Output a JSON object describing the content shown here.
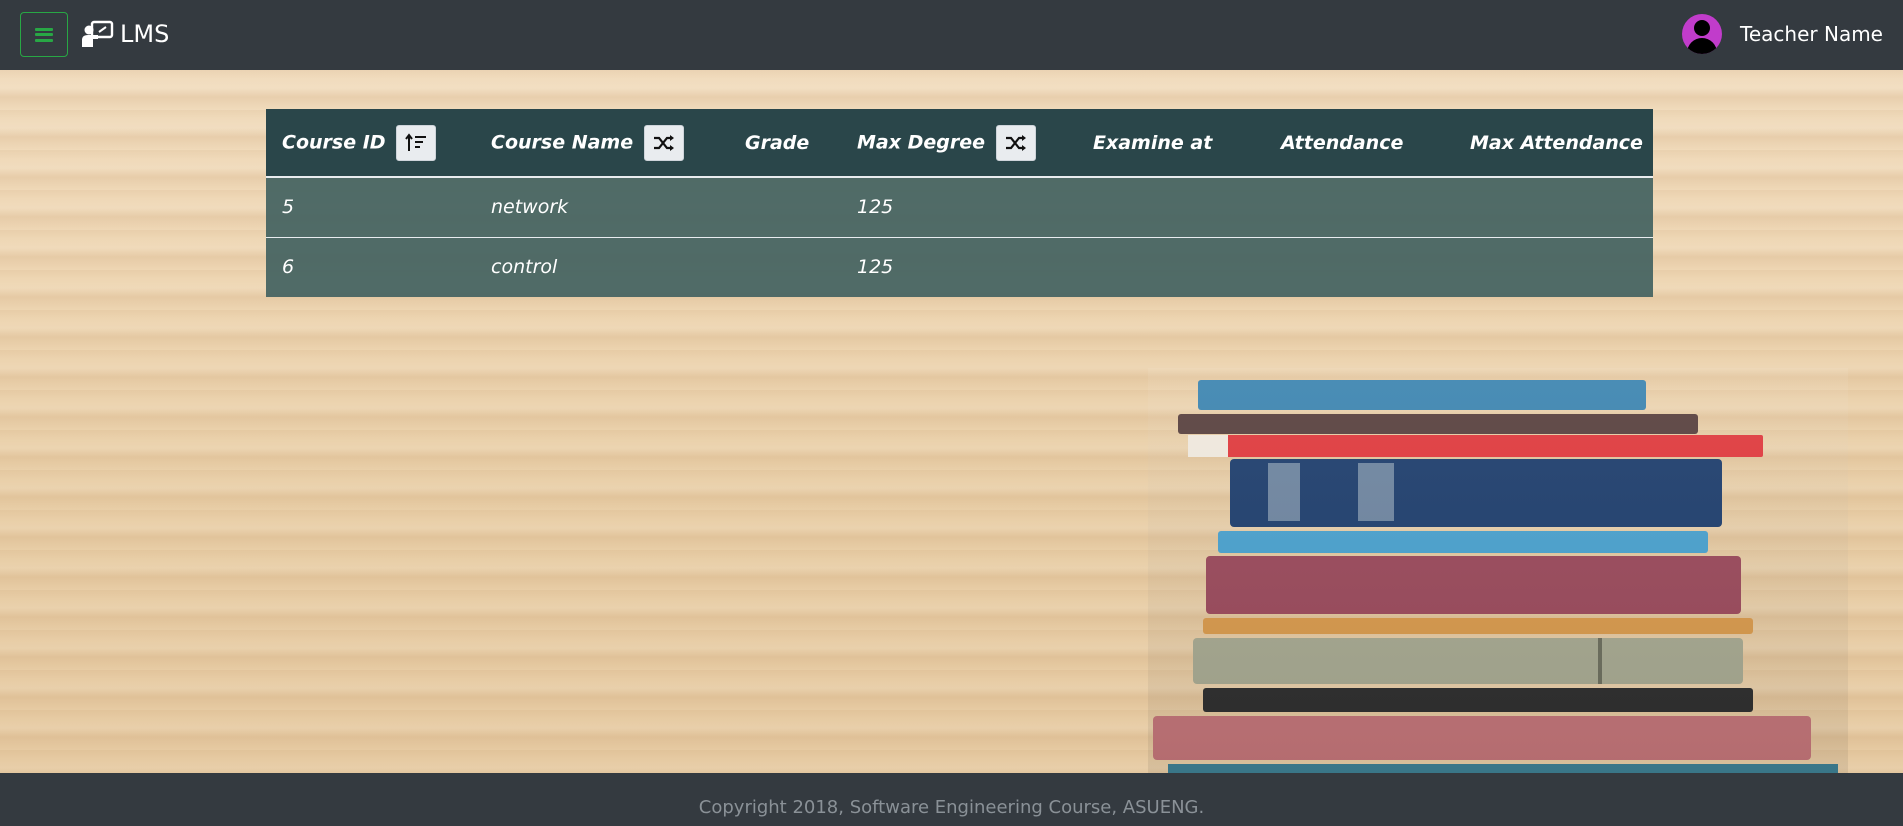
{
  "navbar": {
    "brand": "LMS",
    "user_name": "Teacher Name"
  },
  "table": {
    "headers": {
      "course_id": "Course ID",
      "course_name": "Course Name",
      "grade": "Grade",
      "max_degree": "Max Degree",
      "examine_at": "Examine at",
      "attendance": "Attendance",
      "max_attendance": "Max Attendance"
    },
    "rows": [
      {
        "course_id": "5",
        "course_name": "network",
        "grade": "",
        "max_degree": "125",
        "examine_at": "",
        "attendance": "",
        "max_attendance": ""
      },
      {
        "course_id": "6",
        "course_name": "control",
        "grade": "",
        "max_degree": "125",
        "examine_at": "",
        "attendance": "",
        "max_attendance": ""
      }
    ]
  },
  "footer": {
    "copyright": "Copyright 2018, Software Engineering Course, ASUENG."
  },
  "icons": {
    "menu": "hamburger-icon",
    "brand": "teacher-board-icon",
    "avatar": "user-avatar-icon",
    "sort_course_id": "sort-amount-icon",
    "sort_course_name": "shuffle-icon",
    "sort_max_degree": "shuffle-icon"
  },
  "colors": {
    "navbar": "#343a40",
    "menu_accent": "#28a745",
    "table_header": "#23414a",
    "table_row": "#46645e",
    "avatar": "#c13ccb"
  }
}
